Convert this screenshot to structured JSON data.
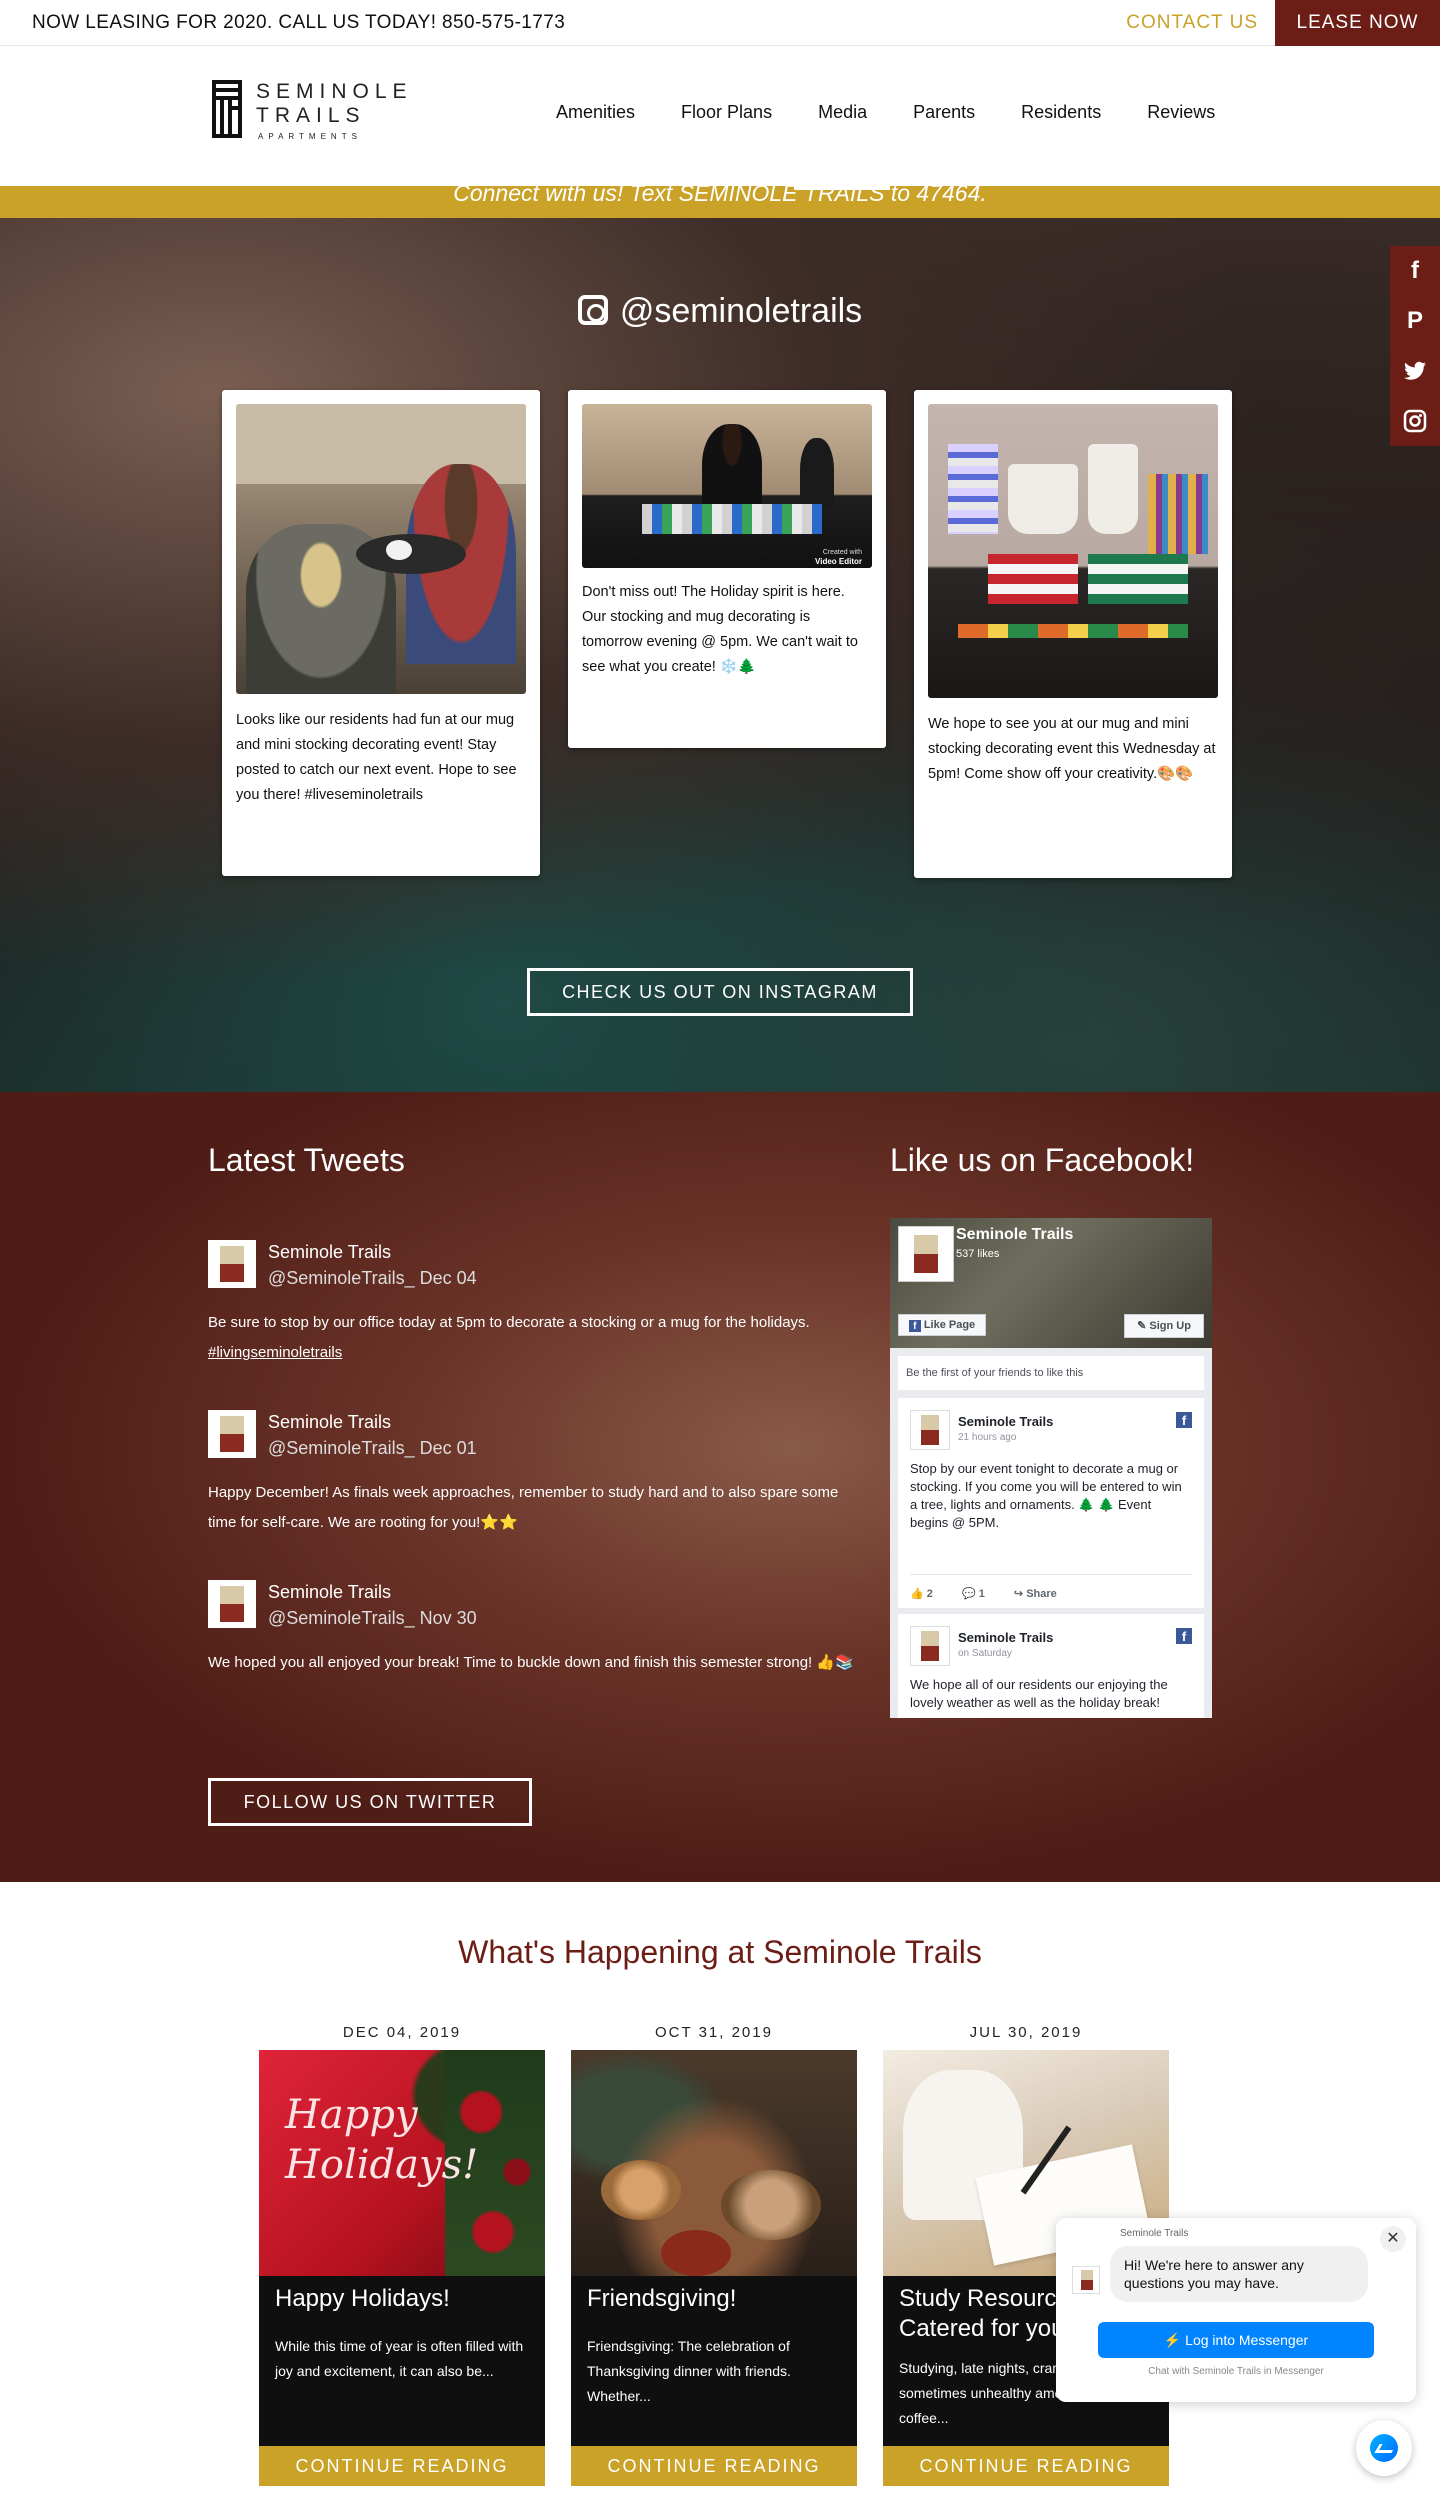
{
  "topbar": {
    "lease_text": "NOW LEASING FOR 2020. CALL US TODAY! 850-575-1773",
    "contact": "CONTACT US",
    "lease_now": "LEASE NOW"
  },
  "logo": {
    "line1": "SEMINOLE",
    "line2": "TRAILS",
    "line3": "APARTMENTS"
  },
  "nav": [
    "Amenities",
    "Floor Plans",
    "Media",
    "Parents",
    "Residents",
    "Reviews"
  ],
  "banner": {
    "text": "Connect with us! Text SEMINOLE TRAILS to 47464."
  },
  "instagram": {
    "handle": "@seminoletrails",
    "posts": [
      "Looks like our residents had fun at our mug and mini stocking decorating event! Stay posted to catch our next event. Hope to see you there! #liveseminoletrails",
      "Don't miss out! The Holiday spirit is here. Our stocking and mug decorating is tomorrow evening @ 5pm. We can't wait to see what you create! ❄️🌲",
      "We hope to see you at our mug and mini stocking decorating event this Wednesday at 5pm! Come show off your creativity.🎨🎨"
    ],
    "video_editor": "Video Editor",
    "created_with": "Created with",
    "button": "CHECK US OUT ON INSTAGRAM"
  },
  "social": [
    "facebook-icon",
    "pinterest-icon",
    "twitter-icon",
    "instagram-icon"
  ],
  "tweets": {
    "title": "Latest Tweets",
    "items": [
      {
        "name": "Seminole Trails",
        "handle": "@SeminoleTrails_ Dec 04",
        "text": "Be sure to stop by our office today at 5pm to decorate a stocking or a mug for the holidays.",
        "link": "#livingseminoletrails"
      },
      {
        "name": "Seminole Trails",
        "handle": "@SeminoleTrails_ Dec 01",
        "text": "Happy December! As finals week approaches, remember to study hard and to also spare some time for self-care. We are rooting for you!⭐⭐"
      },
      {
        "name": "Seminole Trails",
        "handle": "@SeminoleTrails_ Nov 30",
        "text": "We hoped you all enjoyed your break! Time to buckle down and finish this semester strong! 👍📚"
      }
    ],
    "button": "FOLLOW US ON TWITTER"
  },
  "facebook": {
    "title": "Like us on Facebook!",
    "page_name": "Seminole Trails",
    "likes": "537 likes",
    "like_page": "Like Page",
    "sign_up": "Sign Up",
    "friends": "Be the first of your friends to like this",
    "posts": [
      {
        "name": "Seminole Trails",
        "time": "21 hours ago",
        "text": "Stop by our event tonight to decorate a mug or stocking. If you come you will be entered to win a tree, lights and ornaments. 🌲 🌲 Event begins @ 5PM.",
        "likes": "2",
        "comments": "1",
        "share": "Share"
      },
      {
        "name": "Seminole Trails",
        "time": "on Saturday",
        "text": "We hope all of our residents our enjoying the lovely weather as well as the holiday break!"
      }
    ]
  },
  "happening": {
    "title": "What's Happening at Seminole Trails",
    "posts": [
      {
        "date": "DEC 04, 2019",
        "title": "Happy Holidays!",
        "image_text": "Happy Holidays!",
        "excerpt": "While this time of year is often filled with joy and excitement, it can also be...",
        "more": "CONTINUE READING"
      },
      {
        "date": "OCT 31, 2019",
        "title": "Friendsgiving!",
        "excerpt": "Friendsgiving: The celebration of Thanksgiving dinner with friends. Whether...",
        "more": "CONTINUE READING"
      },
      {
        "date": "JUL 30, 2019",
        "title": "Study Resources Catered for you",
        "excerpt": "Studying, late nights, cramming, and sometimes unhealthy amounts of coffee...",
        "more": "CONTINUE READING"
      }
    ]
  },
  "messenger": {
    "page": "Seminole Trails",
    "message": "Hi! We're here to answer any questions you may have.",
    "login": "Log into Messenger",
    "chat": "Chat with Seminole Trails in Messenger"
  },
  "colors": {
    "brand": "#6b1d16",
    "accent": "#c9a227",
    "messenger": "#0084ff"
  }
}
